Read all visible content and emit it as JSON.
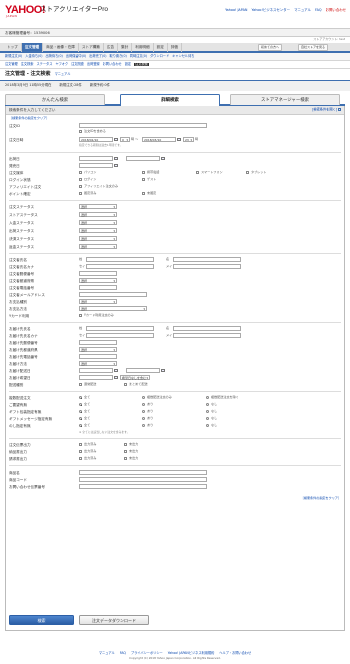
{
  "header": {
    "logo": "YAHOO!",
    "logo_sub": "JAPAN",
    "app_title": "ストアクリエイターPro",
    "links": [
      "Yahoo! JAPAN",
      "Yahoo!ビジネスセンター",
      "マニュアル",
      "FAQ",
      "お問い合わせ"
    ]
  },
  "store_bar": {
    "label": "お客様管理番号：",
    "value": "1539006"
  },
  "sub_right": "ストアアカウント: test",
  "nav": {
    "tabs": [
      "トップ",
      "注文管理",
      "商品・画像・在庫",
      "ストア構築",
      "広告",
      "集計",
      "利用明細",
      "設定",
      "評価"
    ],
    "active_index": 1,
    "extra": [
      "初めての方へ",
      "自社ストアを見る"
    ]
  },
  "subnav": [
    "新規注文(0)",
    "入金待ち(0)",
    "出荷待ち(0)",
    "出荷保留中(0)",
    "出荷完了(0)",
    "取り置き(0)",
    "同時注文(0)",
    "ダウンロード",
    "キャンセル待ち"
  ],
  "subnav2": {
    "items": [
      "注文管理",
      "注文検索",
      "ステータス",
      "ヤフオク",
      "注文関連",
      "出荷登録",
      "お問い合わせ",
      "設定",
      "注文検索"
    ],
    "current_index": 8
  },
  "page": {
    "title": "注文管理 - 注文検索",
    "manual_link": "マニュアル"
  },
  "date_bar": {
    "date": "2018年3月9日 11時55分現在",
    "today_orders": "新規注文:28件",
    "today_sales": "新規予約:0件"
  },
  "search_tabs": {
    "tabs": [
      "かんたん検索",
      "詳細検索",
      "ストアマネージャー検索"
    ],
    "active_index": 1
  },
  "box": {
    "heading": "検索条件を入力してください",
    "open_link": "[検索条件を開く]",
    "saved_link": "［検索条件の指定をクリア］"
  },
  "fields": {
    "order_id": {
      "label": "注文ID",
      "checkbox": "注文IDを含める"
    },
    "order_date": {
      "label": "注文日時",
      "from_date": "2018/02/10",
      "from_hour": "0",
      "to_date": "2018/03/10",
      "to_hour": "23",
      "hint": "指定できる期間は過去1年間です。"
    },
    "ship_date": {
      "label": "出荷日"
    },
    "release_date": {
      "label": "発売日"
    },
    "device": {
      "label": "注文媒体",
      "options": [
        "パソコン",
        "携帯電話",
        "スマートフォン",
        "タブレット"
      ]
    },
    "login": {
      "label": "ログイン状態",
      "options": [
        "ログイン",
        "ゲスト"
      ]
    },
    "affiliate": {
      "label": "アフィリエイト注文",
      "options": [
        "アフィリエイト注文のみ"
      ]
    },
    "points": {
      "label": "ポイント確定",
      "options": [
        "確定済み",
        "未確定"
      ]
    },
    "status": [
      {
        "label": "注文ステータス",
        "value": "選択"
      },
      {
        "label": "ストアステータス",
        "value": "選択"
      },
      {
        "label": "入金ステータス",
        "value": "選択"
      },
      {
        "label": "出荷ステータス",
        "value": "選択"
      },
      {
        "label": "決済ステータス",
        "value": "選択"
      },
      {
        "label": "返金ステータス",
        "value": "選択"
      }
    ],
    "orderer": {
      "labels": [
        "注文者氏名",
        "注文者氏名カナ",
        "注文者郵便番号",
        "注文者都道府県",
        "注文者電話番号",
        "注文者メールアドレス",
        "お支払種別",
        "お支払方法",
        "Yカード利用"
      ],
      "sei": "姓",
      "mei": "名",
      "sei_kana": "セイ",
      "mei_kana": "メイ",
      "pref_value": "選択",
      "pay_value": "選択",
      "pay_method_value": "選択",
      "ycard": "Yカード利用注文のみ"
    },
    "shipto": {
      "labels": [
        "お届け先氏名",
        "お届け先氏名カナ",
        "お届け先郵便番号",
        "お届け先都道府県",
        "お届け先電話番号",
        "お届け方法",
        "お届け配送日",
        "お届け希望日",
        "配送種別"
      ],
      "pref_value": "選択",
      "method_value": "選択",
      "hope_value": "希望日なしを含む",
      "types": [
        "通常配送",
        "まとめて配送"
      ]
    },
    "flags": {
      "labels": [
        "複数配送注文",
        "ご要望有無",
        "ギフト包装指定有無",
        "ギフトメッセージ指定有無",
        "のし指定有無"
      ],
      "choices": [
        [
          "全て",
          "複数配送注文のみ",
          "複数配送注文を除く"
        ],
        [
          "全て",
          "あり",
          "なし"
        ],
        [
          "全て",
          "あり",
          "なし"
        ],
        [
          "全て",
          "あり",
          "なし"
        ],
        [
          "全て",
          "あり",
          "なし"
        ]
      ],
      "note": "※ 全てには該当しない注文を含みます。"
    },
    "print": {
      "labels": [
        "注文伝票出力",
        "納品書出力",
        "請求書出力"
      ],
      "choices": [
        "出力済み",
        "未出力"
      ]
    },
    "product": {
      "labels": [
        "商品名",
        "商品コード",
        "お問い合わせ伝票番号"
      ]
    }
  },
  "buttons": {
    "search": "検索",
    "download": "注文データダウンロード"
  },
  "footer": {
    "links": [
      "マニュアル",
      "FAQ",
      "プライバシーポリシー",
      "Yahoo! JAPANビジネス利用規約",
      "ヘルプ・お問い合わせ"
    ],
    "copyright": "Copyright (C) 2018 Yahoo Japan Corporation. All Rights Reserved."
  }
}
